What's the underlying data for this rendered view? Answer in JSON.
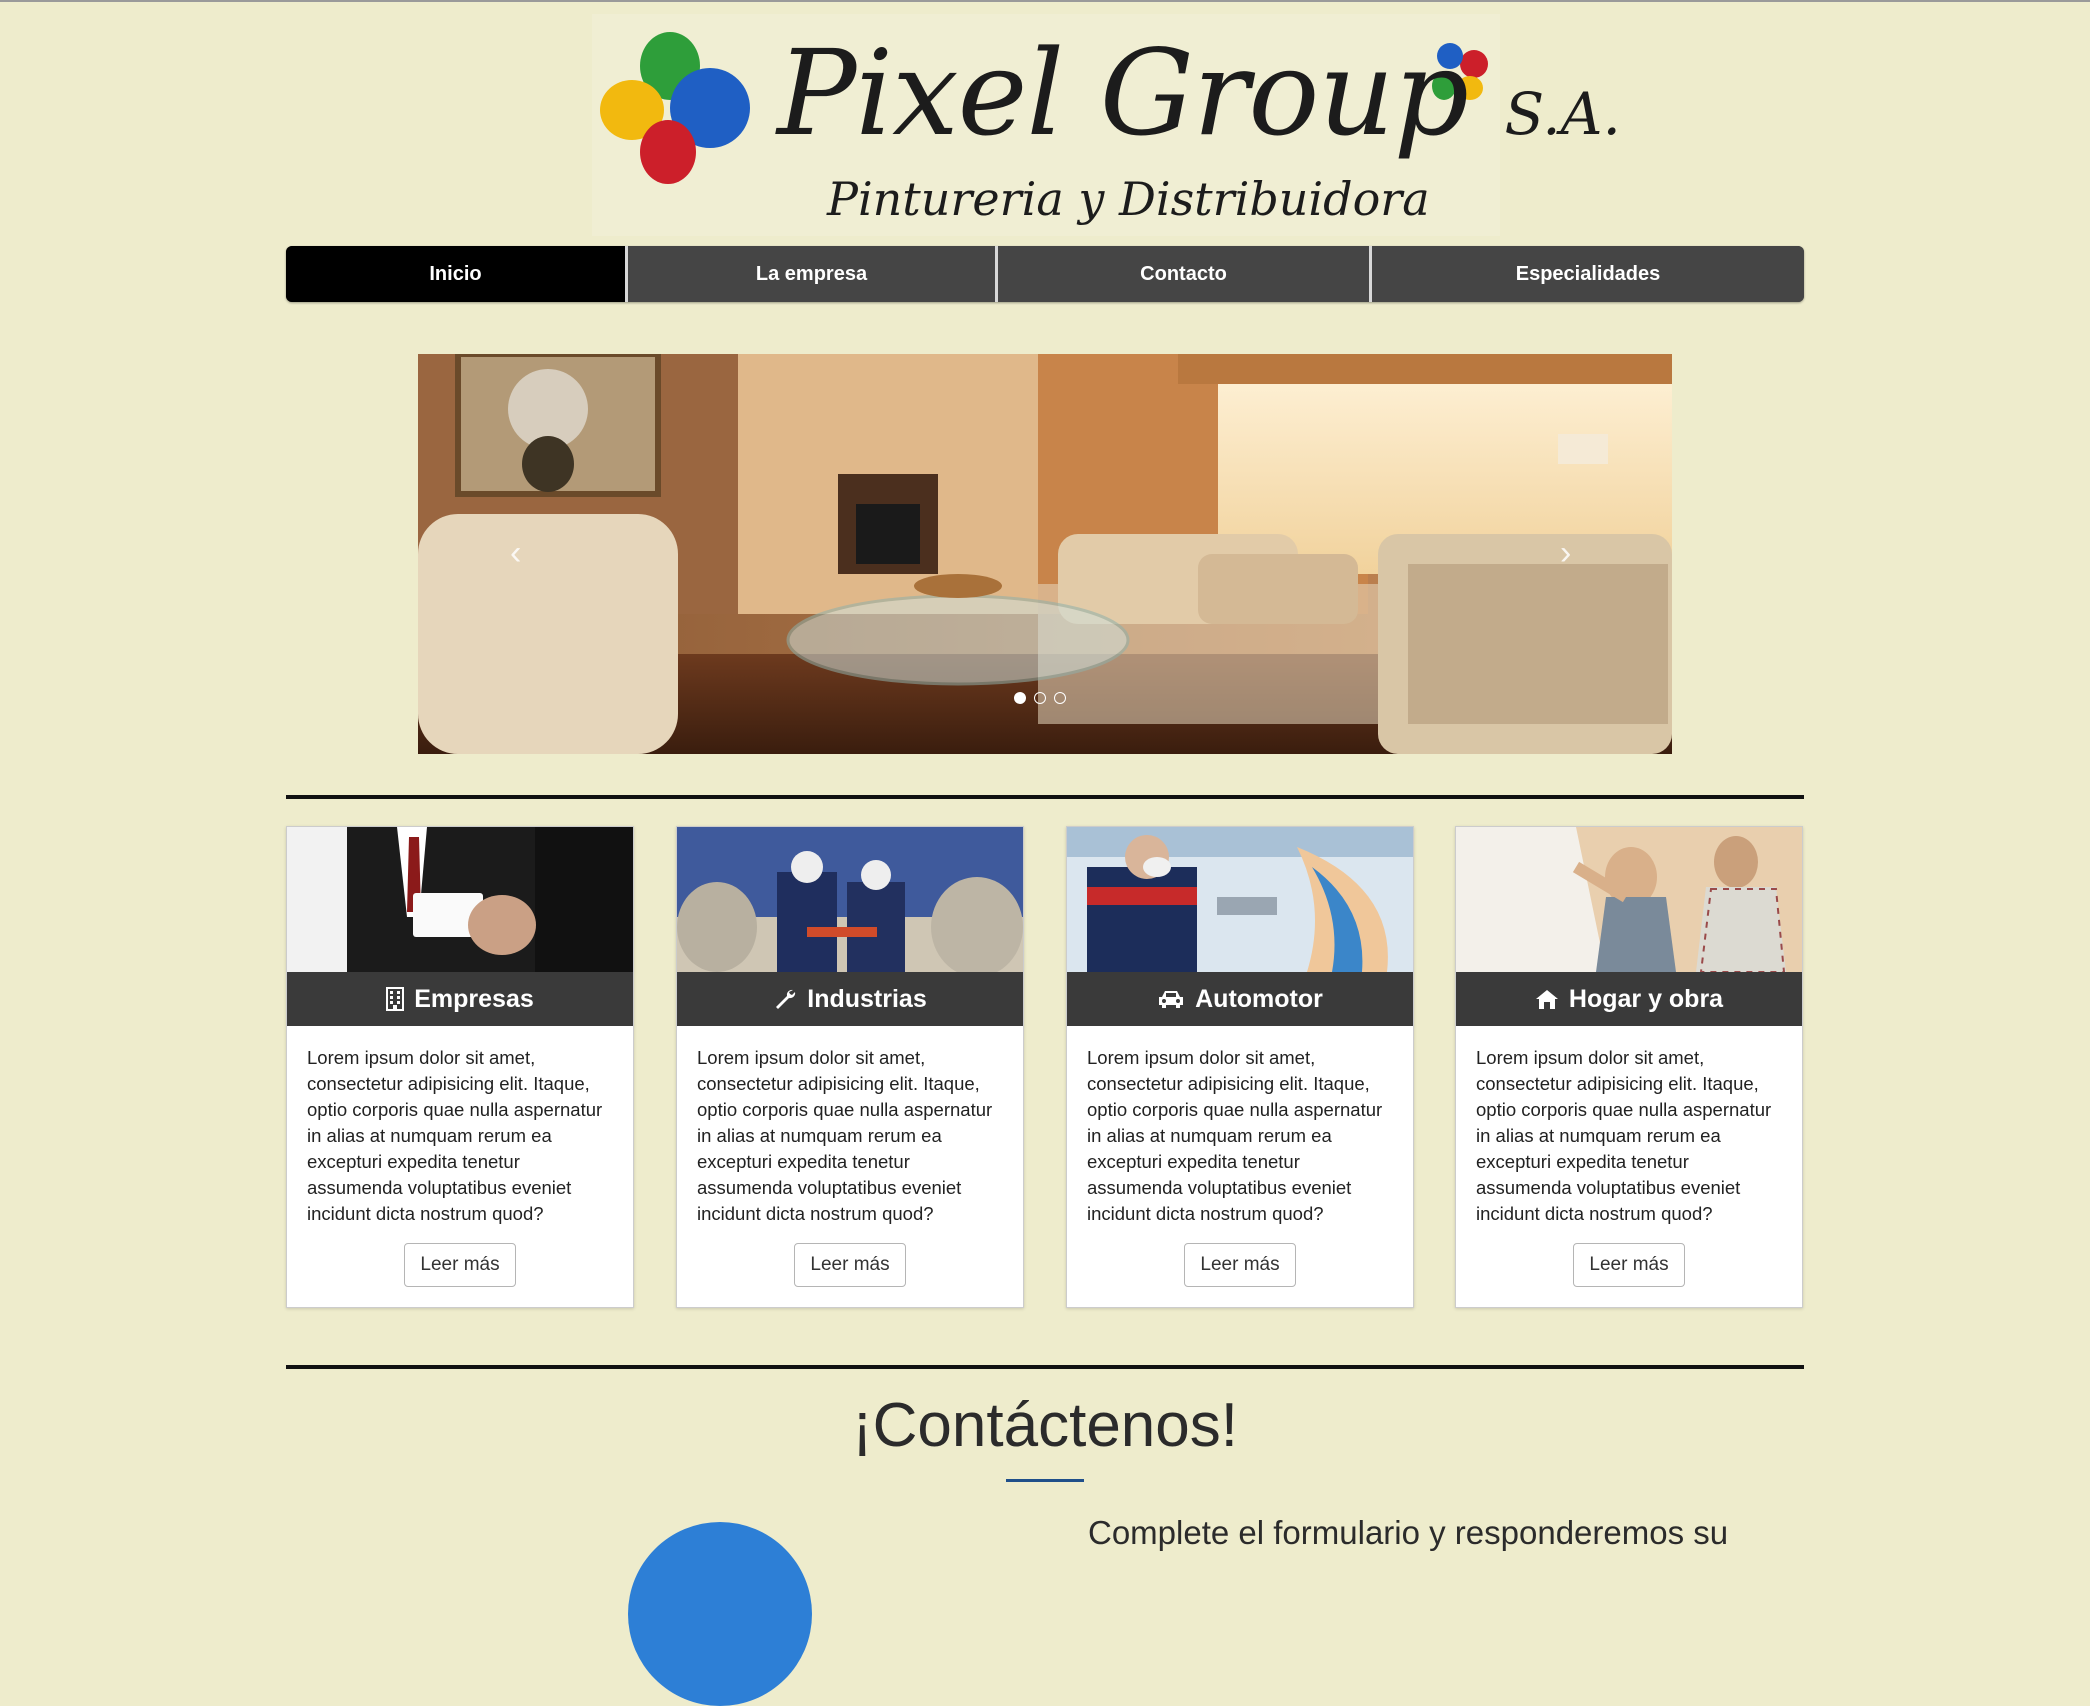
{
  "brand": {
    "name": "Pixel Group",
    "suffix": "S.A.",
    "tagline": "Pintureria y Distribuidora"
  },
  "nav": {
    "items": [
      {
        "label": "Inicio",
        "active": true
      },
      {
        "label": "La empresa",
        "active": false
      },
      {
        "label": "Contacto",
        "active": false
      },
      {
        "label": "Especialidades",
        "active": false
      }
    ]
  },
  "carousel": {
    "prev_icon": "chevron-left-icon",
    "next_icon": "chevron-right-icon",
    "prev_glyph": "‹",
    "next_glyph": "›",
    "slides_count": 3,
    "active_index": 0
  },
  "cards": [
    {
      "title": "Empresas",
      "icon": "building-icon",
      "text": "Lorem ipsum dolor sit amet, consectetur adipisicing elit. Itaque, optio corporis quae nulla aspernatur in alias at numquam rerum ea excepturi expedita tenetur assumenda voluptatibus eveniet incidunt dicta nostrum quod?",
      "button": "Leer más"
    },
    {
      "title": "Industrias",
      "icon": "wrench-icon",
      "text": "Lorem ipsum dolor sit amet, consectetur adipisicing elit. Itaque, optio corporis quae nulla aspernatur in alias at numquam rerum ea excepturi expedita tenetur assumenda voluptatibus eveniet incidunt dicta nostrum quod?",
      "button": "Leer más"
    },
    {
      "title": "Automotor",
      "icon": "car-icon",
      "text": "Lorem ipsum dolor sit amet, consectetur adipisicing elit. Itaque, optio corporis quae nulla aspernatur in alias at numquam rerum ea excepturi expedita tenetur assumenda voluptatibus eveniet incidunt dicta nostrum quod?",
      "button": "Leer más"
    },
    {
      "title": "Hogar y obra",
      "icon": "home-icon",
      "text": "Lorem ipsum dolor sit amet, consectetur adipisicing elit. Itaque, optio corporis quae nulla aspernatur in alias at numquam rerum ea excepturi expedita tenetur assumenda voluptatibus eveniet incidunt dicta nostrum quod?",
      "button": "Leer más"
    }
  ],
  "contact": {
    "title": "¡Contáctenos!",
    "lead": "Complete el formulario y responderemos su"
  },
  "colors": {
    "page_bg": "#eeeccc",
    "nav_bg": "#454545",
    "nav_active": "#000000",
    "card_head": "#3a3a3a",
    "accent_blue": "#2d7fd6"
  }
}
